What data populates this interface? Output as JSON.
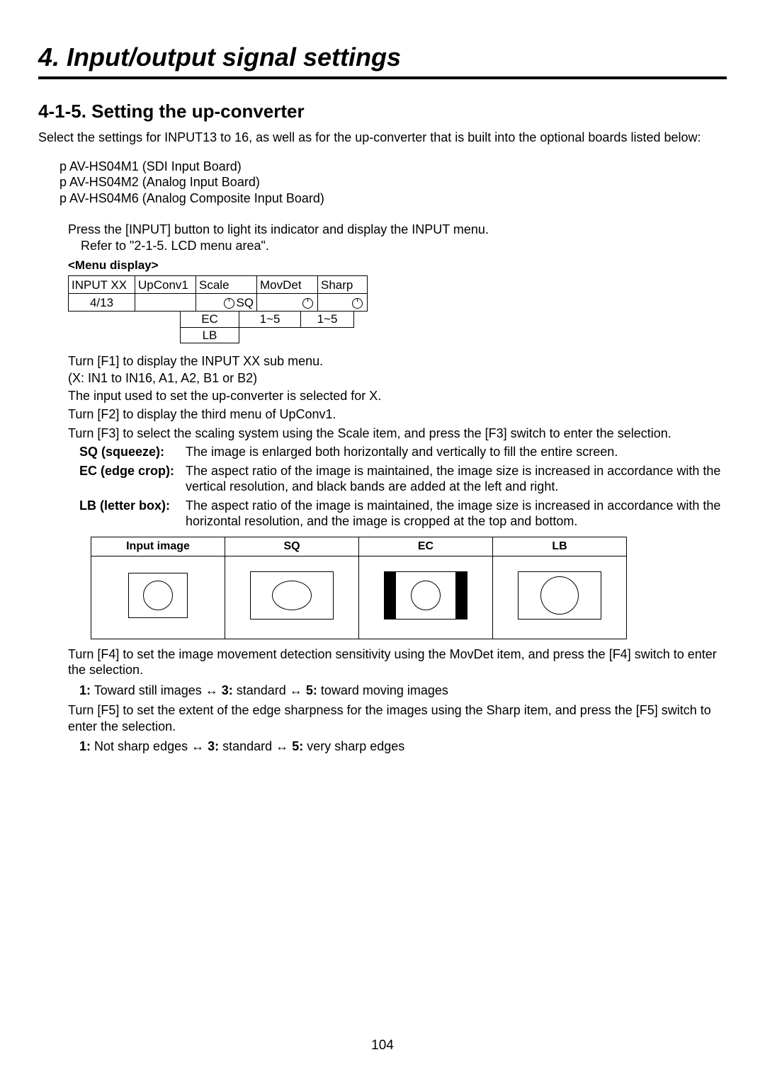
{
  "chapter_title": "4. Input/output signal settings",
  "section_title": "4-1-5. Setting the up-converter",
  "intro": "Select the settings for INPUT13 to 16, as well as for the up-converter that is built into the optional boards listed below:",
  "boards": {
    "b1": "p AV-HS04M1 (SDI Input Board)",
    "b2": "p AV-HS04M2 (Analog Input Board)",
    "b3": "p AV-HS04M6 (Analog Composite Input Board)"
  },
  "step1": {
    "line1": "Press the [INPUT] button to light its indicator and display the INPUT menu.",
    "line2": "Refer to \"2-1-5. LCD menu area\"."
  },
  "menu_label": "<Menu display>",
  "menu": {
    "c1": "INPUT XX",
    "c2": "UpConv1",
    "c3": "Scale",
    "c4": "MovDet",
    "c5": "Sharp",
    "r2c1": "4/13",
    "r2sq": "SQ",
    "opt_ec": "EC",
    "opt_lb": "LB",
    "opt_movdet": "1~5",
    "opt_sharp": "1~5"
  },
  "turn_f1": {
    "line1": "Turn [F1] to display the INPUT XX sub menu.",
    "line2": "(X: IN1 to IN16, A1, A2, B1 or B2)",
    "line3": "The input used to set the up-converter is selected for X."
  },
  "turn_f2": "Turn [F2] to display the third menu of UpConv1.",
  "turn_f3": "Turn [F3] to select the scaling system using the Scale item, and press the [F3] switch to enter the selection.",
  "defs": {
    "sq_term": "SQ (squeeze):",
    "sq_desc": "The image is enlarged both horizontally and vertically to fill the entire screen.",
    "ec_term": "EC (edge crop):",
    "ec_desc": "The aspect ratio of the image is maintained, the image size is increased in accordance with the vertical resolution, and black bands are added at the left and right.",
    "lb_term": "LB (letter box):",
    "lb_desc": "The aspect ratio of the image is maintained, the image size is increased in accordance with the horizontal resolution, and the image is cropped at the top and bottom."
  },
  "diagram_headers": {
    "h1": "Input image",
    "h2": "SQ",
    "h3": "EC",
    "h4": "LB"
  },
  "turn_f4": "Turn [F4] to set the image movement detection sensitivity using the MovDet item, and press the [F4] switch to enter the selection.",
  "movdet_scale": {
    "k1": "1:",
    "v1": " Toward still images  ↔  ",
    "k3": "3:",
    "v3": " standard  ↔  ",
    "k5": "5:",
    "v5": " toward moving images"
  },
  "turn_f5": "Turn [F5] to set the extent of the edge sharpness for the images using the Sharp item, and press the [F5] switch to enter the selection.",
  "sharp_scale": {
    "k1": "1:",
    "v1": " Not sharp edges  ↔  ",
    "k3": "3:",
    "v3": " standard  ↔  ",
    "k5": "5:",
    "v5": " very sharp edges"
  },
  "page_number": "104"
}
